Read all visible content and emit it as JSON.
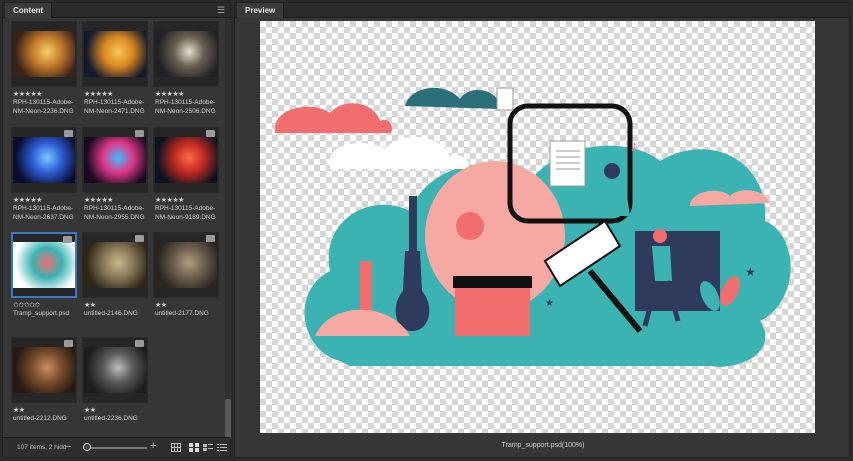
{
  "content_panel": {
    "tab_label": "Content",
    "menu_icon": "hamburger-icon",
    "items": [
      {
        "name": "RPH-130115-Adobe-NM-Neon-2236.DNG",
        "stars": "★★★★★",
        "palette": [
          "#3a2218",
          "#c47a2a",
          "#f4d06a"
        ],
        "badge": false
      },
      {
        "name": "RPH-130115-Adobe-NM-Neon-2471.DNG",
        "stars": "★★★★★",
        "palette": [
          "#141a2e",
          "#d9881f",
          "#f6c85a"
        ],
        "badge": false
      },
      {
        "name": "RPH-130115-Adobe-NM-Neon-2506.DNG",
        "stars": "★★★★★",
        "palette": [
          "#1f2125",
          "#6b6050",
          "#e4e0d2"
        ],
        "badge": false
      },
      {
        "name": "RPH-130115-Adobe-NM-Neon-2637.DNG",
        "stars": "★★★★★",
        "palette": [
          "#0a0c30",
          "#2b5fd6",
          "#7fc8ff"
        ],
        "badge": true
      },
      {
        "name": "RPH-130115-Adobe-NM-Neon-2955.DNG",
        "stars": "★★★★★",
        "palette": [
          "#1a0a20",
          "#e0398a",
          "#39c0ff"
        ],
        "badge": true
      },
      {
        "name": "RPH-130115-Adobe-NM-Neon-9189.DNG",
        "stars": "★★★★★",
        "palette": [
          "#0e1320",
          "#c02a20",
          "#ff6a4a"
        ],
        "badge": true
      },
      {
        "name": "Tramp_support.psd",
        "stars": "✩✩✩✩✩",
        "palette": [
          "#ffffff",
          "#3bb3b3",
          "#f26d6d"
        ],
        "badge": true
      },
      {
        "name": "untitled-2146.DNG",
        "stars": "★★",
        "palette": [
          "#2e2618",
          "#8a7a5a",
          "#c8b98a"
        ],
        "badge": true
      },
      {
        "name": "untitled-2177.DNG",
        "stars": "★★",
        "palette": [
          "#2a2420",
          "#6d6150",
          "#b39e80"
        ],
        "badge": true
      },
      {
        "name": "untitled-2212.DNG",
        "stars": "★★",
        "palette": [
          "#261a12",
          "#7a4e2e",
          "#c4925a"
        ],
        "badge": true
      },
      {
        "name": "untitled-2236.DNG",
        "stars": "★★",
        "palette": [
          "#1c1c1c",
          "#5a5a5a",
          "#bdbdbd"
        ],
        "badge": true
      }
    ],
    "selected_index": 6,
    "footer": {
      "count_text": "107 items, 2 hidd",
      "zoom_minus": "−",
      "zoom_plus": "+",
      "zoom_level": 0.0
    }
  },
  "preview_panel": {
    "tab_label": "Preview",
    "caption": "Tramp_support.psd(100%)",
    "colors": {
      "teal": "#3bb3b3",
      "dark_teal": "#2a6f7a",
      "coral": "#f26d6d",
      "pink": "#f6a9a3",
      "navy": "#2f3b5c",
      "white": "#ffffff",
      "black": "#111111"
    }
  },
  "colors": {
    "accent_selected": "#3d76c7",
    "panel_bg": "#363636",
    "app_bg": "#2b2b2b"
  }
}
